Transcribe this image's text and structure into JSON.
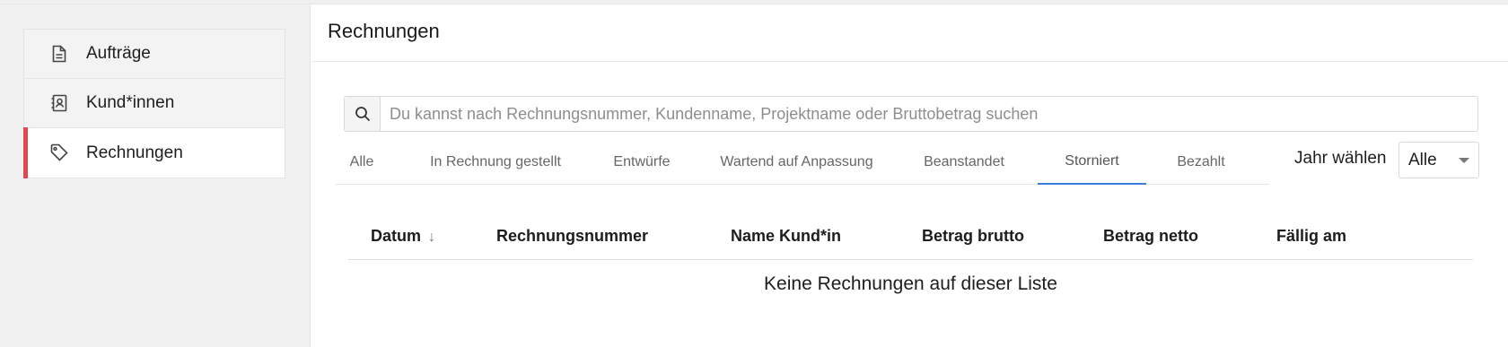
{
  "sidebar": {
    "items": [
      {
        "label": "Aufträge",
        "icon": "document-icon",
        "active": false
      },
      {
        "label": "Kund*innen",
        "icon": "contact-book-icon",
        "active": false
      },
      {
        "label": "Rechnungen",
        "icon": "tag-icon",
        "active": true
      }
    ],
    "accent_color": "#e0474f"
  },
  "header": {
    "title": "Rechnungen"
  },
  "search": {
    "placeholder": "Du kannst nach Rechnungsnummer, Kundenname, Projektname oder Bruttobetrag suchen",
    "value": "",
    "icon": "search-icon"
  },
  "tabs": [
    {
      "label": "Alle",
      "active": false
    },
    {
      "label": "In Rechnung gestellt",
      "active": false
    },
    {
      "label": "Entwürfe",
      "active": false
    },
    {
      "label": "Wartend auf Anpassung",
      "active": false
    },
    {
      "label": "Beanstandet",
      "active": false
    },
    {
      "label": "Storniert",
      "active": true
    },
    {
      "label": "Bezahlt",
      "active": false
    }
  ],
  "tab_accent_color": "#3b7ddd",
  "year_filter": {
    "label": "Jahr wählen",
    "selected": "Alle"
  },
  "table": {
    "columns": [
      "Datum",
      "Rechnungsnummer",
      "Name Kund*in",
      "Betrag brutto",
      "Betrag netto",
      "Fällig am"
    ],
    "sorted_column": "Datum",
    "sort_direction": "descending",
    "rows": [],
    "empty_message": "Keine Rechnungen auf dieser Liste"
  }
}
